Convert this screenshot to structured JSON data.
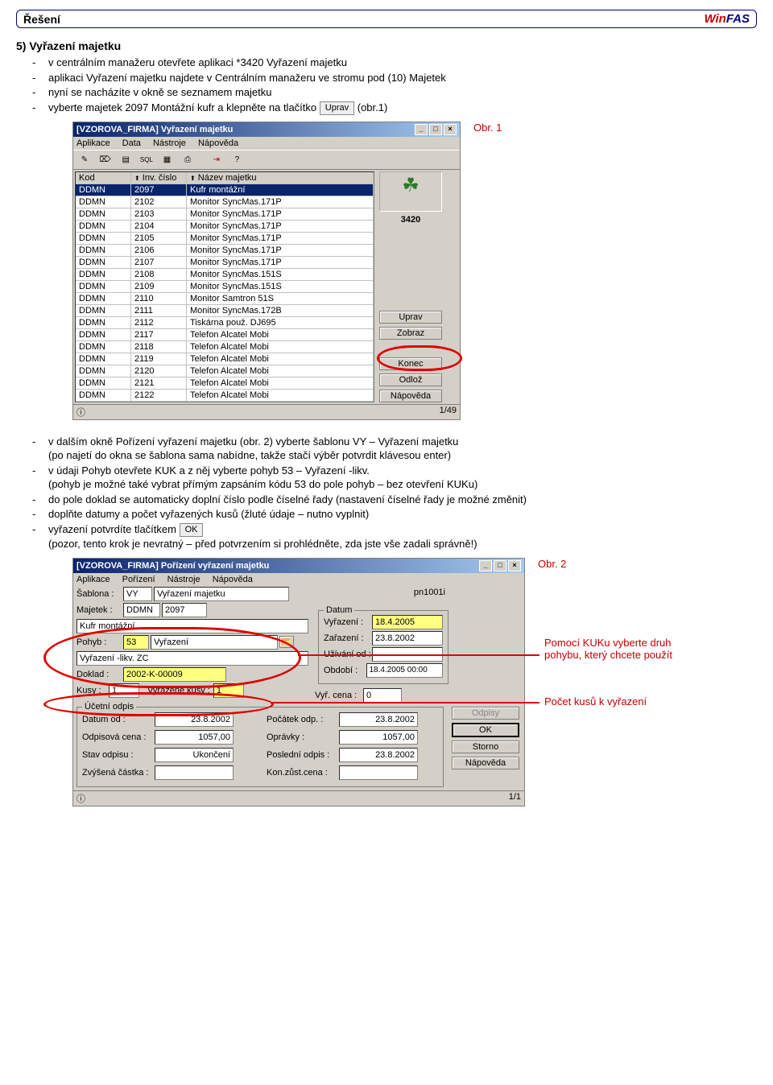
{
  "header": {
    "title": "Řešení",
    "brand_w": "Win",
    "brand_rest": "FAS"
  },
  "section5": {
    "title": "5) Vyřazení majetku",
    "bullets": [
      "v centrálním manažeru otevřete aplikaci *3420 Vyřazení majetku",
      "aplikaci Vyřazení majetku najdete v Centrálním manažeru ve stromu pod (10) Majetek",
      "nyní se nacházíte v okně se seznamem majetku"
    ],
    "bullet4_a": "vyberte majetek 2097 Montážní kufr a klepněte na tlačítko",
    "btn_uprav": "Uprav",
    "bullet4_b": " (obr.1)",
    "fig1": "Obr. 1"
  },
  "win1": {
    "title": "[VZOROVA_FIRMA] Vyřazení majetku",
    "menu": [
      "Aplikace",
      "Data",
      "Nástroje",
      "Nápověda"
    ],
    "cols": {
      "kod": "Kod",
      "inv": "Inv. číslo",
      "nazev": "Název majetku"
    },
    "rows": [
      {
        "k": "DDMN",
        "i": "2097",
        "n": "Kufr montážní",
        "sel": true
      },
      {
        "k": "DDMN",
        "i": "2102",
        "n": "Monitor SyncMas.171P"
      },
      {
        "k": "DDMN",
        "i": "2103",
        "n": "Monitor SyncMas.171P"
      },
      {
        "k": "DDMN",
        "i": "2104",
        "n": "Monitor SyncMas.171P"
      },
      {
        "k": "DDMN",
        "i": "2105",
        "n": "Monitor SyncMas.171P"
      },
      {
        "k": "DDMN",
        "i": "2106",
        "n": "Monitor SyncMas.171P"
      },
      {
        "k": "DDMN",
        "i": "2107",
        "n": "Monitor SyncMas.171P"
      },
      {
        "k": "DDMN",
        "i": "2108",
        "n": "Monitor SyncMas.151S"
      },
      {
        "k": "DDMN",
        "i": "2109",
        "n": "Monitor SyncMas.151S"
      },
      {
        "k": "DDMN",
        "i": "2110",
        "n": "Monitor Samtron  51S"
      },
      {
        "k": "DDMN",
        "i": "2111",
        "n": "Monitor SyncMas.172B"
      },
      {
        "k": "DDMN",
        "i": "2112",
        "n": "Tiskárna použ. DJ695"
      },
      {
        "k": "DDMN",
        "i": "2117",
        "n": "Telefon Alcatel Mobi"
      },
      {
        "k": "DDMN",
        "i": "2118",
        "n": "Telefon Alcatel Mobi"
      },
      {
        "k": "DDMN",
        "i": "2119",
        "n": "Telefon Alcatel Mobi"
      },
      {
        "k": "DDMN",
        "i": "2120",
        "n": "Telefon Alcatel Mobi"
      },
      {
        "k": "DDMN",
        "i": "2121",
        "n": "Telefon Alcatel Mobi"
      },
      {
        "k": "DDMN",
        "i": "2122",
        "n": "Telefon Alcatel Mobi"
      }
    ],
    "side_code": "3420",
    "btns": {
      "uprav": "Uprav",
      "zobraz": "Zobraz",
      "konec": "Konec",
      "odloz": "Odlož",
      "napoveda": "Nápověda"
    },
    "status": "1/49"
  },
  "middle": {
    "b1a": "v dalším okně Pořízení vyřazení majetku (obr. 2) vyberte šablonu VY – Vyřazení majetku",
    "b1b": "(po najetí do okna se šablona sama nabídne, takže stačí výběr potvrdit klávesou enter)",
    "b2a": "v údaji Pohyb otevřete KUK a z něj vyberte pohyb 53 – Vyřazení -likv.",
    "b2b": "(pohyb je možné také vybrat přímým zapsáním kódu 53 do pole pohyb – bez otevření KUKu)",
    "b3": "do pole doklad se automaticky doplní číslo podle číselné řady (nastavení číselné řady je možné změnit)",
    "b4": "doplňte datumy a počet vyřazených kusů (žluté údaje – nutno vyplnit)",
    "b5a": "vyřazení potvrdíte tlačítkem",
    "btn_ok": "OK",
    "b5b": "(pozor, tento krok je nevratný – před potvrzením si prohlédněte, zda jste vše zadali správně!)",
    "fig2": "Obr. 2"
  },
  "win2": {
    "title": "[VZOROVA_FIRMA] Pořízení vyřazení majetku",
    "menu": [
      "Aplikace",
      "Pořízení",
      "Nástroje",
      "Nápověda"
    ],
    "sablona_lbl": "Šablona :",
    "sablona_code": "VY",
    "sablona_name": "Vyřazení majetku",
    "majetek_lbl": "Majetek :",
    "majetek_code": "DDMN",
    "majetek_num": "2097",
    "majetek_name": "Kufr montážní",
    "pohyb_lbl": "Pohyb :",
    "pohyb_code": "53",
    "pohyb_name": "Vyřazení",
    "pohyb_full": "Vyřazení -likv. ZC",
    "doklad_lbl": "Doklad :",
    "doklad_val": "2002-K-00009",
    "kusy_lbl": "Kusy :",
    "kusy_val": "1",
    "vyrkusy_lbl": "Vyřazené kusy :",
    "vyrkusy_val": "1",
    "vyrcena_lbl": "Vyř. cena :",
    "vyrcena_val": "0",
    "datum_legend": "Datum",
    "vyrazeni_lbl": "Vyřazení :",
    "vyrazeni_val": "18.4.2005",
    "zarazeni_lbl": "Zařazení :",
    "zarazeni_val": "23.8.2002",
    "uzivani_lbl": "Užívání od :",
    "uzivani_val": "",
    "obdobi_lbl": "Období :",
    "obdobi_val": "18.4.2005 00:00",
    "ucto_legend": "Účetní odpis",
    "datumod_lbl": "Datum od :",
    "datumod_val": "23.8.2002",
    "pocatek_lbl": "Počátek odp. :",
    "pocatek_val": "23.8.2002",
    "odpcena_lbl": "Odpisová cena :",
    "odpcena_val": "1057,00",
    "opravky_lbl": "Oprávky :",
    "opravky_val": "1057,00",
    "stav_lbl": "Stav odpisu :",
    "stav_val": "Ukončení",
    "posl_lbl": "Poslední odpis :",
    "posl_val": "23.8.2002",
    "zvys_lbl": "Zvýšená částka :",
    "zvys_val": "",
    "konzust_lbl": "Kon.zůst.cena :",
    "konzust_val": "",
    "pn": "pn1001i",
    "btns": {
      "odpisy": "Odpisy",
      "ok": "OK",
      "storno": "Storno",
      "napoveda": "Nápověda"
    },
    "status": "1/1"
  },
  "annots": {
    "a1": "Pomocí KUKu vyberte druh pohybu, který chcete použít",
    "a2": "Počet kusů k vyřazení"
  }
}
